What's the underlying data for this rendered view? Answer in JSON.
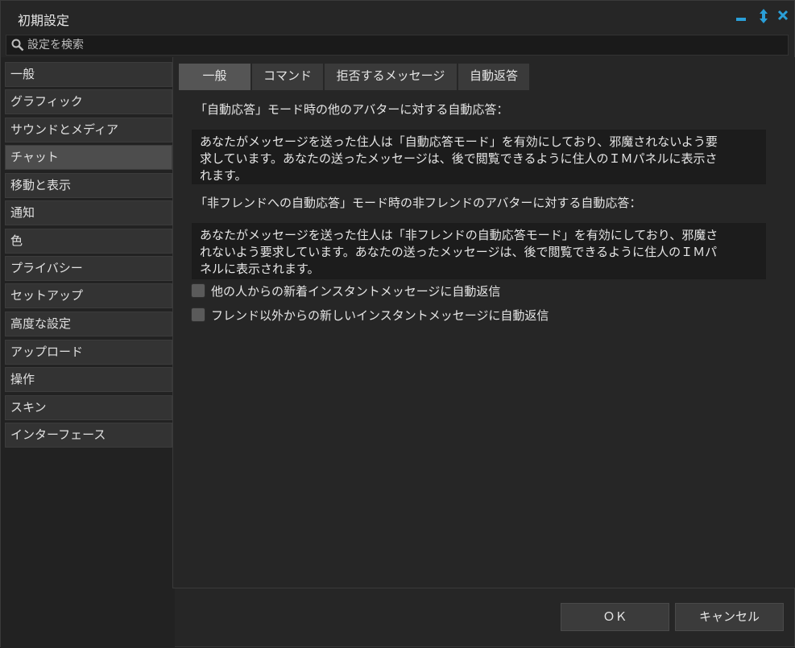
{
  "window": {
    "title": "初期設定"
  },
  "titlebar_icons": [
    "minimize-icon",
    "resize-icon",
    "close-icon"
  ],
  "search": {
    "placeholder": "設定を検索"
  },
  "sidebar": {
    "items": [
      {
        "label": "一般"
      },
      {
        "label": "グラフィック"
      },
      {
        "label": "サウンドとメディア"
      },
      {
        "label": "チャット",
        "active": true
      },
      {
        "label": "移動と表示"
      },
      {
        "label": "通知"
      },
      {
        "label": "色"
      },
      {
        "label": "プライバシー"
      },
      {
        "label": "セットアップ"
      },
      {
        "label": "高度な設定"
      },
      {
        "label": "アップロード"
      },
      {
        "label": "操作"
      },
      {
        "label": "スキン"
      },
      {
        "label": "インターフェース"
      }
    ]
  },
  "tabs": [
    {
      "label": "一般",
      "active": true
    },
    {
      "label": "コマンド"
    },
    {
      "label": "拒否するメッセージ"
    },
    {
      "label": "自動返答"
    }
  ],
  "autoresponse": {
    "label": "「自動応答」モード時の他のアバターに対する自動応答：",
    "lines": [
      "あなたがメッセージを送った住人は「自動応答モード」を有効にしており、邪魔されないよう要",
      "求しています。あなたの送ったメッセージは、後で閲覧できるように住人のＩＭパネルに表示さ",
      "れます。"
    ]
  },
  "nonfriend_autoresponse": {
    "label": "「非フレンドへの自動応答」モード時の非フレンドのアバターに対する自動応答：",
    "lines": [
      "あなたがメッセージを送った住人は「非フレンドの自動応答モード」を有効にしており、邪魔さ",
      "れないよう要求しています。あなたの送ったメッセージは、後で閲覧できるように住人のＩＭパ",
      "ネルに表示されます。"
    ]
  },
  "checkboxes": [
    {
      "label": "他の人からの新着インスタントメッセージに自動返信",
      "checked": false
    },
    {
      "label": "フレンド以外からの新しいインスタントメッセージに自動返信",
      "checked": false
    }
  ],
  "buttons": {
    "ok": "ＯＫ",
    "cancel": "キャンセル"
  },
  "colors": {
    "accent": "#2a9fd8",
    "background": "#262626"
  }
}
